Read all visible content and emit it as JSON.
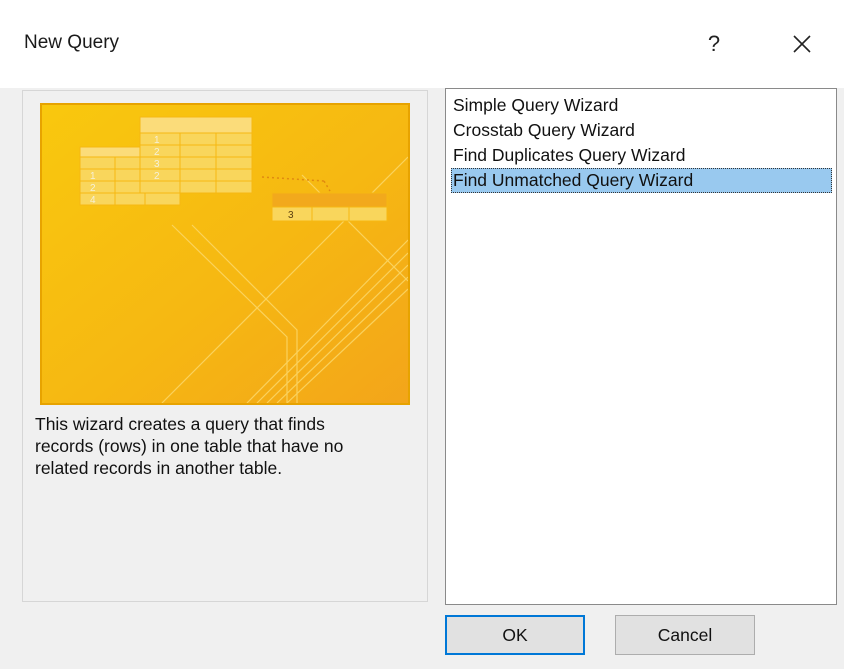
{
  "window": {
    "title": "New Query",
    "help_label": "?"
  },
  "preview": {
    "icon": "query-wizard-illustration",
    "colors": {
      "background": "#f8c40f",
      "border": "#e7a300"
    },
    "table_numbers_left": [
      "1",
      "2",
      "4"
    ],
    "table_numbers_center": [
      "1",
      "2",
      "3",
      "2"
    ],
    "table_numbers_right": [
      "3"
    ]
  },
  "description": "This wizard creates a query that finds records (rows) in one table that have no related records in another table.",
  "list": {
    "items": [
      {
        "label": "Simple Query Wizard",
        "selected": false
      },
      {
        "label": "Crosstab Query Wizard",
        "selected": false
      },
      {
        "label": "Find Duplicates Query Wizard",
        "selected": false
      },
      {
        "label": "Find Unmatched Query Wizard",
        "selected": true
      }
    ],
    "selection_color": "#99c9ef"
  },
  "buttons": {
    "ok": "OK",
    "cancel": "Cancel"
  }
}
